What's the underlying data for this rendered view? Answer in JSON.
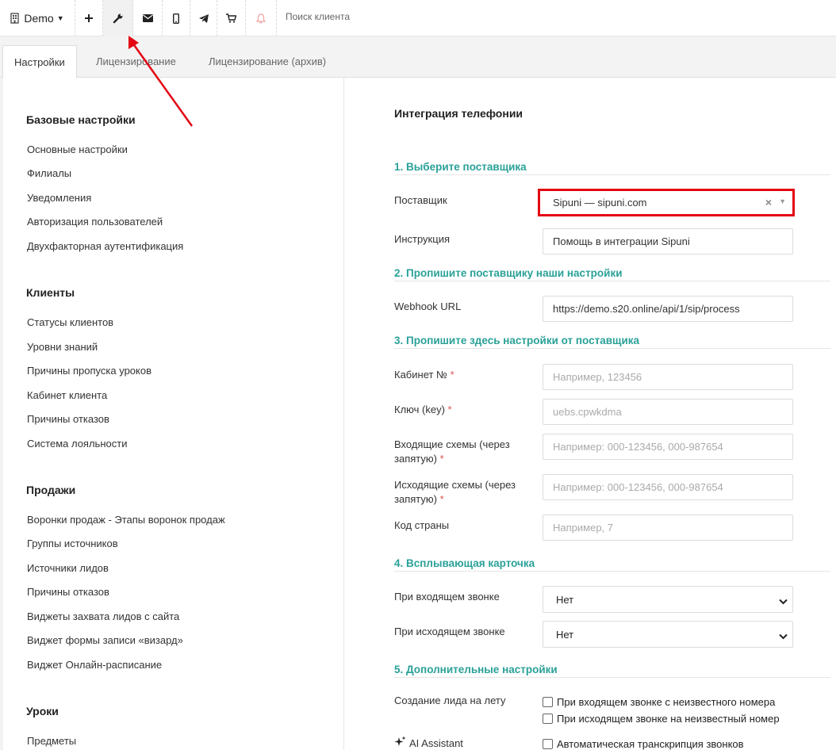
{
  "toolbar": {
    "demo_label": "Demo",
    "search_placeholder": "Поиск клиента",
    "icons": [
      "building-icon",
      "plus-icon",
      "wrench-icon",
      "envelope-icon",
      "mobile-icon",
      "telegram-icon",
      "cart-icon",
      "bell-icon"
    ]
  },
  "tabs": [
    {
      "label": "Настройки",
      "active": true
    },
    {
      "label": "Лицензирование",
      "active": false
    },
    {
      "label": "Лицензирование (архив)",
      "active": false
    }
  ],
  "sidebar": {
    "sections": [
      {
        "title": "Базовые настройки",
        "items": [
          "Основные настройки",
          "Филиалы",
          "Уведомления",
          "Авторизация пользователей",
          "Двухфакторная аутентификация"
        ]
      },
      {
        "title": "Клиенты",
        "items": [
          "Статусы клиентов",
          "Уровни знаний",
          "Причины пропуска уроков",
          "Кабинет клиента",
          "Причины отказов",
          "Система лояльности"
        ]
      },
      {
        "title": "Продажи",
        "items": [
          "Воронки продаж - Этапы воронок продаж",
          "Группы источников",
          "Источники лидов",
          "Причины отказов",
          "Виджеты захвата лидов с сайта",
          "Виджет формы записи «визард»",
          "Виджет Онлайн-расписание"
        ]
      },
      {
        "title": "Уроки",
        "items": [
          "Предметы"
        ]
      }
    ]
  },
  "main": {
    "title": "Интеграция телефонии",
    "steps": {
      "s1": "1. Выберите поставщика",
      "s2": "2. Пропишите поставщику наши настройки",
      "s3": "3. Пропишите здесь настройки от поставщика",
      "s4": "4. Всплывающая карточка",
      "s5": "5. Дополнительные настройки"
    },
    "provider_label": "Поставщик",
    "provider_value": "Sipuni — sipuni.com",
    "instruction_label": "Инструкция",
    "instruction_value": "Помощь в интеграции Sipuni",
    "webhook_label": "Webhook URL",
    "webhook_value": "https://demo.s20.online/api/1/sip/process",
    "cabinet_label": "Кабинет №",
    "cabinet_placeholder": "Например, 123456",
    "key_label": "Ключ (key)",
    "key_placeholder": "uebs.cpwkdma",
    "incoming_label_1": "Входящие схемы (через",
    "incoming_label_2": "запятую)",
    "incoming_placeholder": "Например: 000-123456, 000-987654",
    "outgoing_label_1": "Исходящие схемы (через",
    "outgoing_label_2": "запятую)",
    "outgoing_placeholder": "Например: 000-123456, 000-987654",
    "country_label": "Код страны",
    "country_placeholder": "Например, 7",
    "popup_in_label": "При входящем звонке",
    "popup_in_value": "Нет",
    "popup_out_label": "При исходящем звонке",
    "popup_out_value": "Нет",
    "lead_label": "Создание лида на лету",
    "lead_opt1": "При входящем звонке с неизвестного номера",
    "lead_opt2": "При исходящем звонке на неизвестный номер",
    "ai_label": "AI Assistant",
    "ai_opt1": "Автоматическая транскрипция звонков",
    "required_mark": "*"
  },
  "colors": {
    "accent": "#2aa198",
    "highlight": "#e30613",
    "required": "#e05252"
  }
}
